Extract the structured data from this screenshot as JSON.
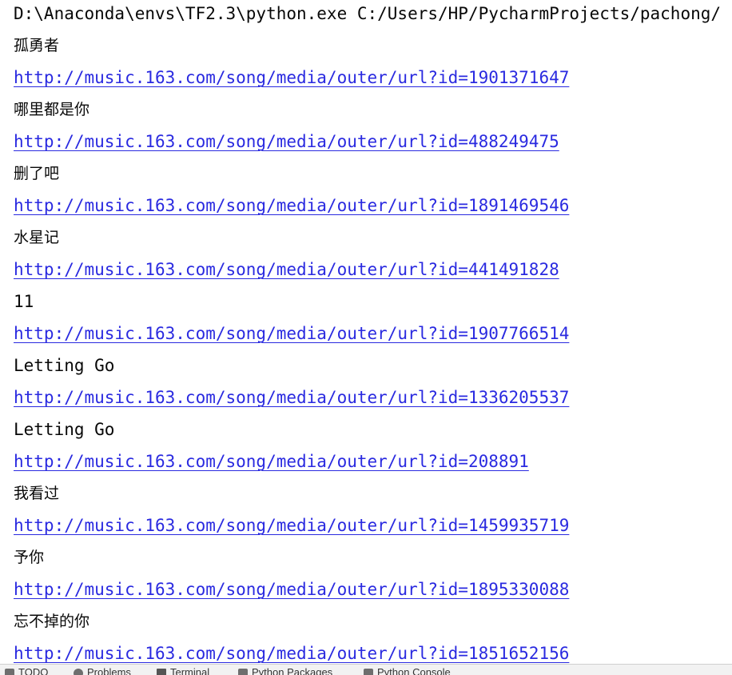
{
  "console": {
    "command": "D:\\Anaconda\\envs\\TF2.3\\python.exe C:/Users/HP/PycharmProjects/pachong/",
    "entries": [
      {
        "title": "孤勇者",
        "url": "http://music.163.com/song/media/outer/url?id=1901371647"
      },
      {
        "title": "哪里都是你",
        "url": "http://music.163.com/song/media/outer/url?id=488249475"
      },
      {
        "title": "删了吧",
        "url": "http://music.163.com/song/media/outer/url?id=1891469546"
      },
      {
        "title": "水星记",
        "url": "http://music.163.com/song/media/outer/url?id=441491828"
      },
      {
        "title": "11",
        "url": "http://music.163.com/song/media/outer/url?id=1907766514"
      },
      {
        "title": "Letting Go",
        "url": "http://music.163.com/song/media/outer/url?id=1336205537"
      },
      {
        "title": "Letting Go",
        "url": "http://music.163.com/song/media/outer/url?id=208891"
      },
      {
        "title": "我看过",
        "url": "http://music.163.com/song/media/outer/url?id=1459935719"
      },
      {
        "title": "予你",
        "url": "http://music.163.com/song/media/outer/url?id=1895330088"
      },
      {
        "title": "忘不掉的你",
        "url": "http://music.163.com/song/media/outer/url?id=1851652156"
      }
    ]
  },
  "bottombar": {
    "tabs": [
      {
        "label": "TODO",
        "icon": "list-icon"
      },
      {
        "label": "Problems",
        "icon": "problems-icon"
      },
      {
        "label": "Terminal",
        "icon": "terminal-icon"
      },
      {
        "label": "Python Packages",
        "icon": "packages-icon"
      },
      {
        "label": "Python Console",
        "icon": "python-console-icon"
      }
    ]
  }
}
